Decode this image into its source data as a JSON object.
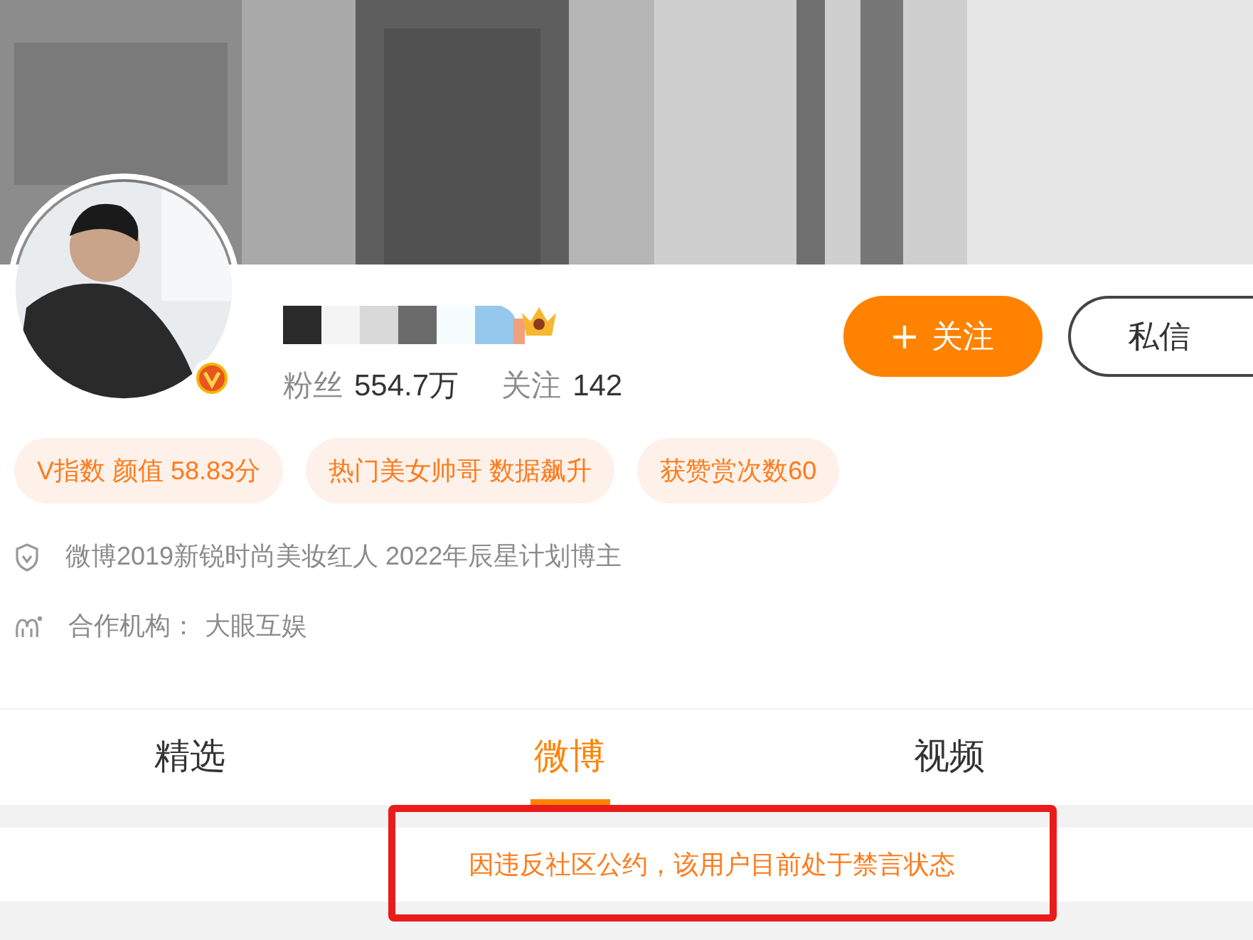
{
  "cover": {
    "kind": "picture"
  },
  "profile": {
    "avatar": {
      "kind": "picture",
      "verified": true
    },
    "stats": [
      {
        "label": "粉丝",
        "value": "554.7万"
      },
      {
        "label": "关注",
        "value": "142"
      }
    ],
    "buttons": [
      {
        "kind": "follow",
        "label": "关注"
      },
      {
        "kind": "message",
        "label": "私信"
      }
    ]
  },
  "tags": [
    "V指数 颜值 58.83分",
    "热门美女帅哥 数据飙升",
    "获赞赏次数60"
  ],
  "info": [
    {
      "kind": "honor",
      "text": "微博2019新锐时尚美妆红人 2022年辰星计划博主"
    },
    {
      "kind": "agency",
      "label": "合作机构：",
      "value": "大眼互娱"
    }
  ],
  "tabs": [
    {
      "label": "精选",
      "selected": false
    },
    {
      "label": "微博",
      "selected": true
    },
    {
      "label": "视频",
      "selected": false
    }
  ],
  "notice": {
    "text": "因违反社区公约，该用户目前处于禁言状态",
    "highlighted": true
  }
}
